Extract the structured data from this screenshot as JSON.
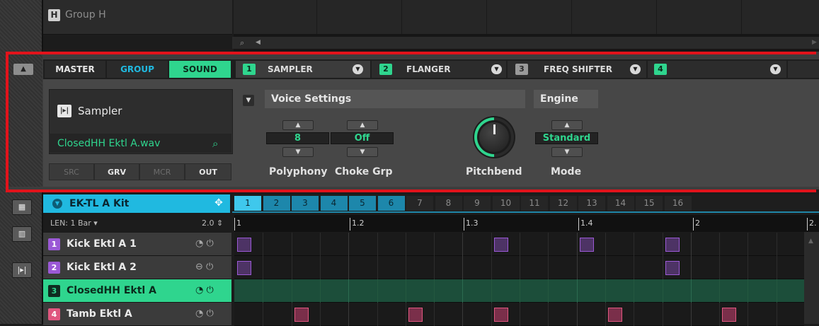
{
  "group_header": {
    "badge": "H",
    "label": "Group H"
  },
  "scroll": {
    "search_glyph": "⌕",
    "left_arrow": "◀",
    "right_arrow": "▶"
  },
  "panel": {
    "collapse_glyph": "▲",
    "tabs": {
      "master": "MASTER",
      "group": "GROUP",
      "sound": "SOUND"
    },
    "slots": [
      {
        "num": "1",
        "name": "SAMPLER"
      },
      {
        "num": "2",
        "name": "FLANGER"
      },
      {
        "num": "3",
        "name": "FREQ SHIFTER"
      },
      {
        "num": "4",
        "name": ""
      }
    ],
    "dropdown_glyph": "▼",
    "plugin": {
      "icon": "|▸|",
      "name": "Sampler",
      "file": "ClosedHH Ektl A.wav",
      "search_glyph": "⌕"
    },
    "buttons": {
      "src": "SRC",
      "grv": "GRV",
      "mcr": "MCR",
      "out": "OUT"
    },
    "section_toggle": "▼",
    "voice_settings": "Voice Settings",
    "engine": "Engine",
    "params": {
      "polyphony": {
        "value": "8",
        "label": "Polyphony"
      },
      "choke": {
        "value": "Off",
        "label": "Choke Grp"
      },
      "pitchbend": {
        "label": "Pitchbend"
      },
      "mode": {
        "value": "Standard",
        "label": "Mode"
      }
    },
    "up_glyph": "▲",
    "down_glyph": "▼"
  },
  "pattern": {
    "kit_arrow": "▼",
    "kit_name": "EK-TL A Kit",
    "move_glyph": "✥",
    "steps": [
      "1",
      "2",
      "3",
      "4",
      "5",
      "6",
      "7",
      "8",
      "9",
      "10",
      "11",
      "12",
      "13",
      "14",
      "15",
      "16"
    ],
    "active_steps": 6,
    "len_label": "LEN: 1 Bar  ▾",
    "len_value": "2.0  ⇕",
    "ruler": [
      "1",
      "1.2",
      "1.3",
      "1.4",
      "2",
      "2."
    ],
    "rows": [
      {
        "num": "1",
        "name": "Kick Ektl A 1",
        "icons": "◔ ⏻",
        "color": "#9b59d6"
      },
      {
        "num": "2",
        "name": "Kick Ektl A 2",
        "icons": "⊖ ⏻",
        "color": "#9b59d6"
      },
      {
        "num": "3",
        "name": "ClosedHH Ektl A",
        "icons": "◔ ⏻",
        "color": "#2fd58e"
      },
      {
        "num": "4",
        "name": "Tamb Ektl A",
        "icons": "◔ ⏻",
        "color": "#e0577f"
      }
    ],
    "notes": [
      {
        "row": 0,
        "steps": [
          1,
          10,
          13,
          16
        ]
      },
      {
        "row": 1,
        "steps": [
          1,
          16
        ]
      },
      {
        "row": 3,
        "steps": [
          3,
          7,
          10,
          14,
          18
        ]
      }
    ]
  },
  "side_icons": [
    "▦",
    "▥",
    "|▸|"
  ],
  "colors": {
    "accent_green": "#2fd58e",
    "accent_blue": "#20b9e0",
    "frame_red": "#e1131b"
  }
}
